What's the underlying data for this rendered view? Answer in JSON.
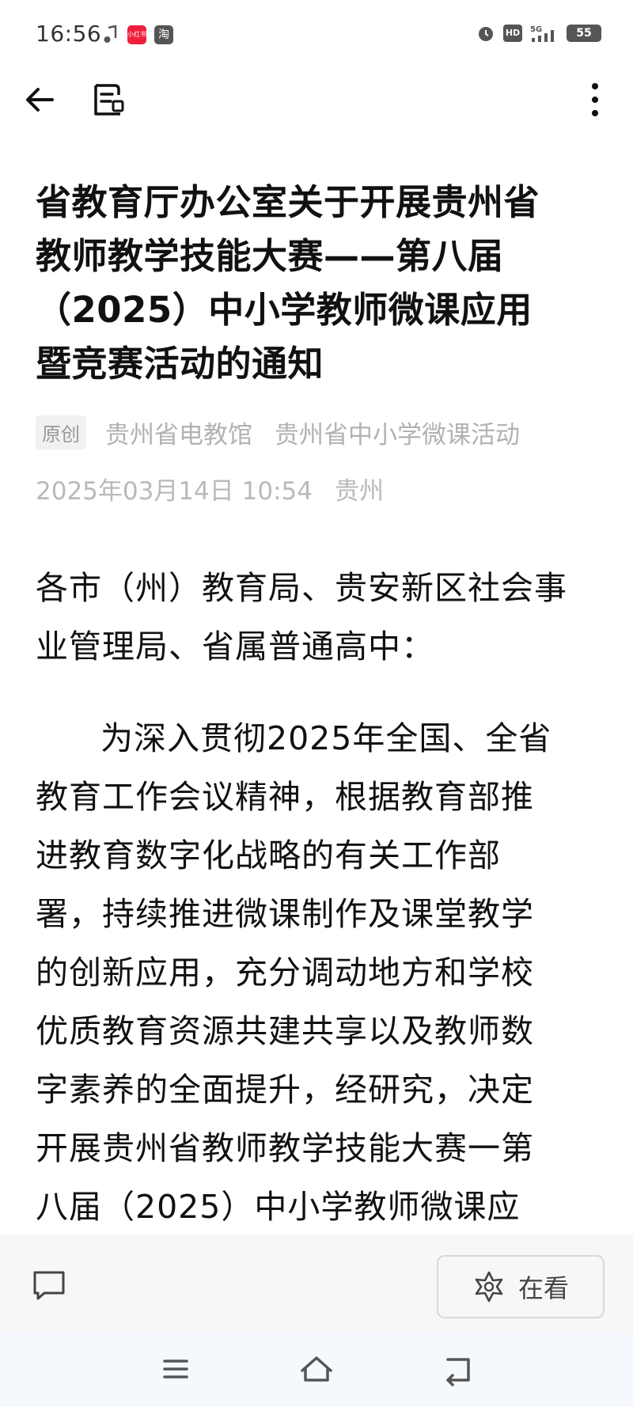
{
  "status_bar": {
    "time": "16:56",
    "app_icon_1_label": "小红书",
    "app_icon_2_label": "淘",
    "hd_label": "HD",
    "network": "5G",
    "battery": "55"
  },
  "icons": {
    "back": "arrow-left-icon",
    "doc": "document-icon",
    "more": "more-vertical-icon",
    "comment": "comment-icon",
    "watch": "flower-star-icon",
    "sys_menu": "menu-lines-icon",
    "sys_home": "home-icon",
    "sys_back": "return-icon"
  },
  "article": {
    "title_lines": [
      "省教育厅办公室关于开展贵州省",
      "教师教学技能大赛——第八届",
      "（2025）中小学教师微课应用",
      "暨竞赛活动的通知"
    ],
    "badge": "原创",
    "source": "贵州省电教馆",
    "account": "贵州省中小学微课活动",
    "publish_time": "2025年03月14日 10:54",
    "location": "贵州",
    "salutation": "各市（州）教育局、贵安新区社会事业管理局、省属普通高中：",
    "body_lines": [
      "为深入贯彻2025年全国、全省",
      "教育工作会议精神，根据教育部推",
      "进教育数字化战略的有关工作部",
      "署，持续推进微课制作及课堂教学",
      "的创新应用，充分调动地方和学校",
      "优质教育资源共建共享以及教师数",
      "字素养的全面提升，经研究，决定",
      "开展贵州省教师教学技能大赛一第",
      "八届（2025）中小学教师微课应"
    ]
  },
  "action_bar": {
    "watch_label": "在看"
  },
  "colors": {
    "meta_gray": "#b2b2b2",
    "action_bar_bg": "#f7f7f7",
    "system_nav_bg": "#f5f8fc"
  }
}
